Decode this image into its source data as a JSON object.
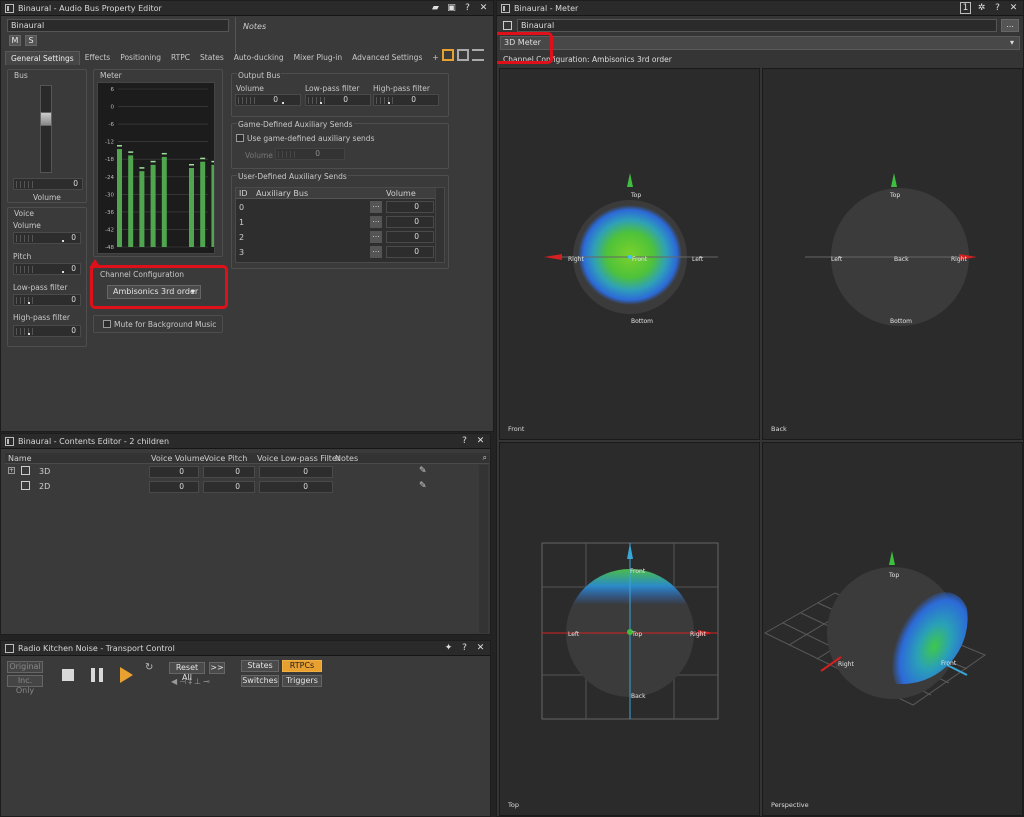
{
  "property_editor": {
    "title": "Binaural - Audio Bus Property Editor",
    "name_value": "Binaural",
    "notes_label": "Notes",
    "mute_label": "M",
    "solo_label": "S",
    "tabs": [
      "General Settings",
      "Effects",
      "Positioning",
      "RTPC",
      "States",
      "Auto-ducking",
      "Mixer Plug-in",
      "Advanced Settings",
      "+"
    ],
    "bus": {
      "label": "Bus",
      "volume_value": "0",
      "volume_label": "Volume"
    },
    "meter": {
      "label": "Meter",
      "scale": [
        "6",
        "0",
        "-6",
        "-12",
        "-18",
        "-24",
        "-30",
        "-36",
        "-42",
        "-48"
      ],
      "levels": [
        0.62,
        0.58,
        0.48,
        0.52,
        0.57,
        0.5,
        0.54,
        0.52
      ],
      "bar_color": "#4fa64f"
    },
    "voice": {
      "label": "Voice",
      "volume_label": "Volume",
      "volume_value": "0",
      "pitch_label": "Pitch",
      "pitch_value": "0",
      "lpf_label": "Low-pass filter",
      "lpf_value": "0",
      "hpf_label": "High-pass filter",
      "hpf_value": "0"
    },
    "output_bus": {
      "label": "Output Bus",
      "volume_label": "Volume",
      "volume_value": "0",
      "lpf_label": "Low-pass filter",
      "lpf_value": "0",
      "hpf_label": "High-pass filter",
      "hpf_value": "0"
    },
    "game_sends": {
      "label": "Game-Defined Auxiliary Sends",
      "checkbox_label": "Use game-defined auxiliary sends",
      "volume_label": "Volume",
      "volume_value": "0"
    },
    "user_sends": {
      "label": "User-Defined Auxiliary Sends",
      "col_id": "ID",
      "col_bus": "Auxiliary Bus",
      "col_volume": "Volume",
      "rows": [
        {
          "id": "0",
          "value": "0"
        },
        {
          "id": "1",
          "value": "0"
        },
        {
          "id": "2",
          "value": "0"
        },
        {
          "id": "3",
          "value": "0"
        }
      ],
      "browse": "..."
    },
    "channel_config": {
      "label": "Channel Configuration",
      "value": "Ambisonics 3rd order"
    },
    "mute_bg_label": "Mute for Background Music"
  },
  "contents_editor": {
    "title": "Binaural - Contents Editor - 2 children",
    "columns": [
      "Name",
      "Voice Volume",
      "Voice Pitch",
      "Voice Low-pass Filter",
      "Notes"
    ],
    "rows": [
      {
        "name": "3D",
        "volume": "0",
        "pitch": "0",
        "lpf": "0"
      },
      {
        "name": "2D",
        "volume": "0",
        "pitch": "0",
        "lpf": "0"
      }
    ]
  },
  "transport": {
    "title": "Radio Kitchen Noise - Transport Control",
    "original": "Original",
    "inc_only": "Inc. Only",
    "reset_all": "Reset All",
    "more": ">>",
    "states": "States",
    "rtpcs": "RTPCs",
    "switches": "Switches",
    "triggers": "Triggers",
    "accent_color": "#e8a030"
  },
  "meter_window": {
    "title": "Binaural - Meter",
    "bus_value": "Binaural",
    "dropdown_value": "3D Meter",
    "browse": "...",
    "channel_config_text": "Channel Configuration: Ambisonics 3rd order",
    "views": {
      "front": {
        "name": "Front",
        "top": "Top",
        "bottom": "Bottom",
        "left": "Right",
        "right": "Left",
        "center": "Front"
      },
      "back": {
        "name": "Back",
        "top": "Top",
        "bottom": "Bottom",
        "left": "Left",
        "right": "Right",
        "center": "Back"
      },
      "top": {
        "name": "Top",
        "top": "Front",
        "bottom": "Back",
        "left": "Left",
        "right": "Right",
        "center": "Top"
      },
      "perspective": {
        "name": "Perspective",
        "top": "Top",
        "left": "Right",
        "right": "Front"
      }
    }
  }
}
